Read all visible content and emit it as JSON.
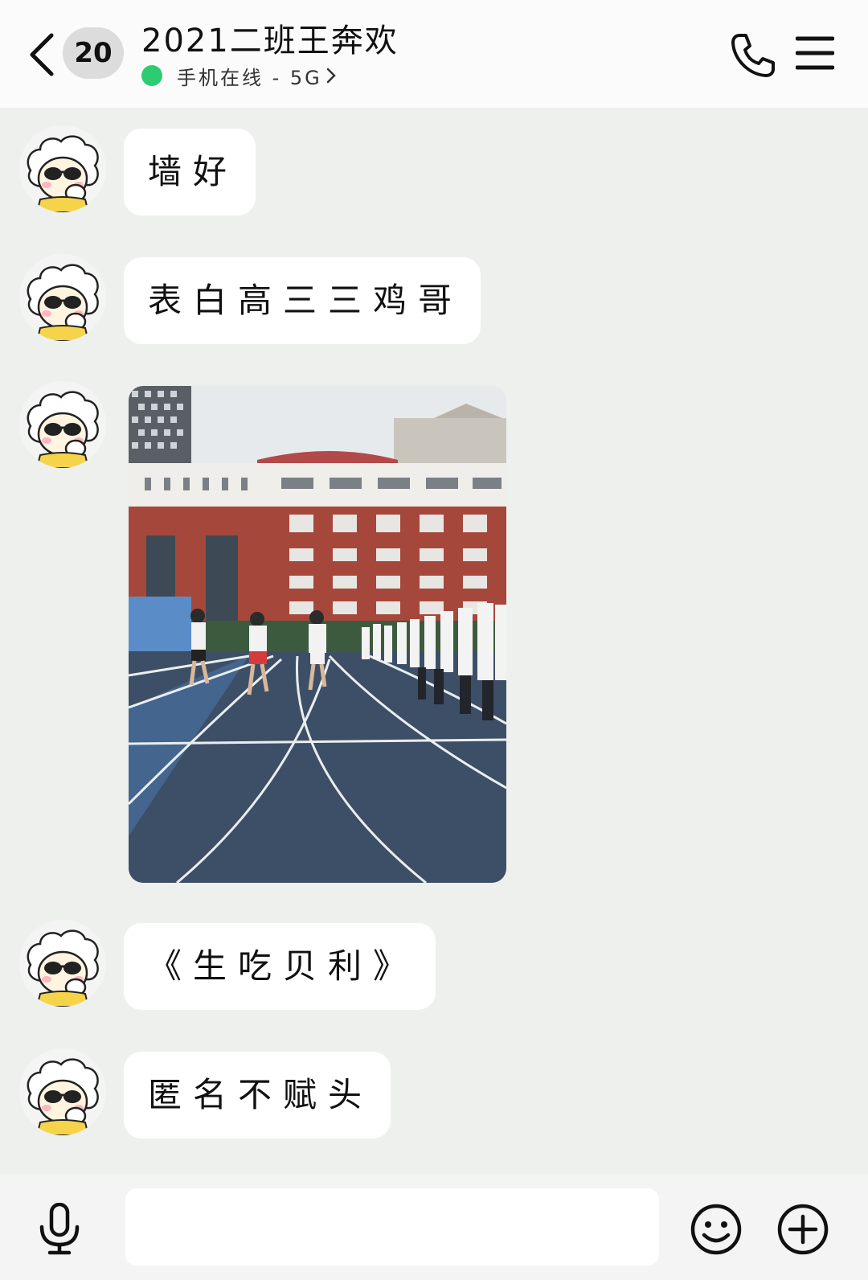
{
  "header": {
    "unread_count": "20",
    "title": "2021二班王奔欢",
    "status": "手机在线 - 5G",
    "online_color": "#2ecc71"
  },
  "messages": [
    {
      "type": "text",
      "text": "墙好"
    },
    {
      "type": "text",
      "text": "表白高三三鸡哥"
    },
    {
      "type": "image",
      "image": "running-track-photo"
    },
    {
      "type": "text",
      "text": "《生吃贝利》"
    },
    {
      "type": "text",
      "text": "匿名不赋头"
    }
  ],
  "input": {
    "placeholder": ""
  },
  "icons": [
    "back-icon",
    "phone-icon",
    "menu-icon",
    "mic-icon",
    "emoji-icon",
    "plus-icon"
  ]
}
